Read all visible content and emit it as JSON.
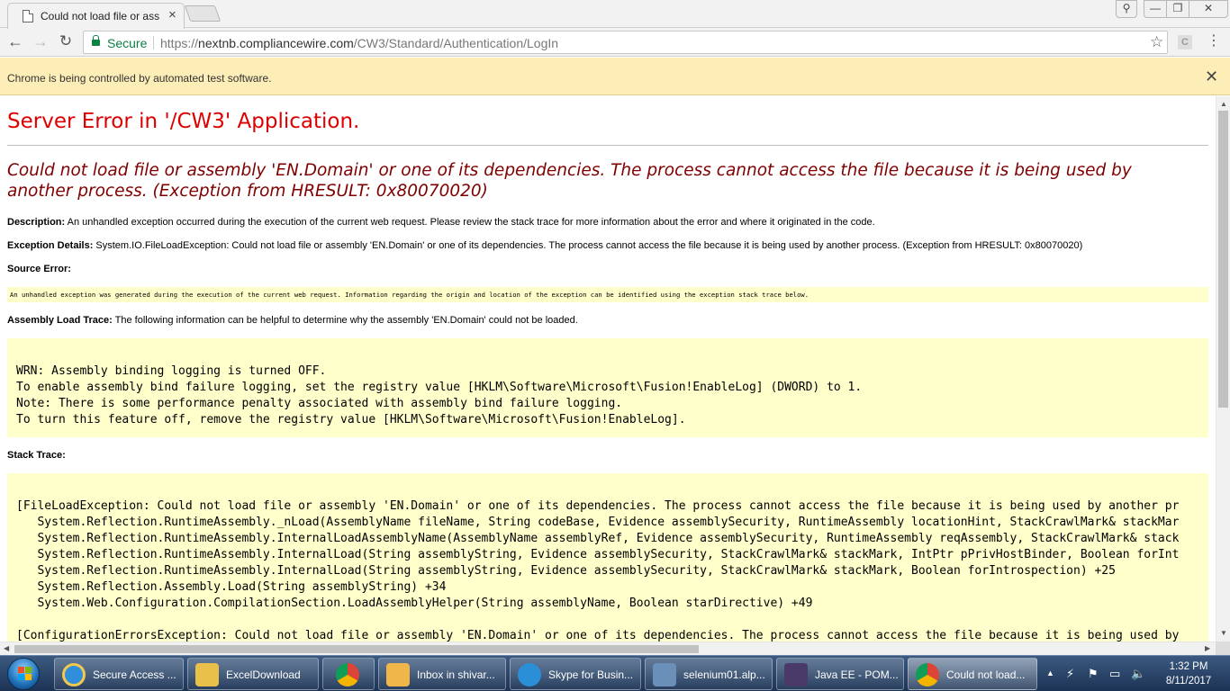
{
  "browser": {
    "tab_title": "Could not load file or ass",
    "tab_close": "×",
    "window_controls": {
      "user": "⚲",
      "minimize": "—",
      "maximize": "❐",
      "close": "✕"
    },
    "nav": {
      "back": "←",
      "forward": "→",
      "reload": "↻"
    },
    "secure_label": "Secure",
    "url_prefix": "https://",
    "url_host": "nextnb.compliancewire.com",
    "url_path": "/CW3/Standard/Authentication/LogIn",
    "star": "☆",
    "ext_label": "C",
    "menu": "⋮"
  },
  "infobar": {
    "text": "Chrome is being controlled by automated test software.",
    "close": "✕"
  },
  "page": {
    "title": "Server Error in '/CW3' Application.",
    "exception_heading": "Could not load file or assembly 'EN.Domain' or one of its dependencies. The process cannot access the file because it is being used by another process. (Exception from HRESULT: 0x80070020)",
    "description_label": "Description:",
    "description_text": " An unhandled exception occurred during the execution of the current web request. Please review the stack trace for more information about the error and where it originated in the code.",
    "exception_details_label": "Exception Details:",
    "exception_details_text": " System.IO.FileLoadException: Could not load file or assembly 'EN.Domain' or one of its dependencies. The process cannot access the file because it is being used by another process. (Exception from HRESULT: 0x80070020)",
    "source_error_label": "Source Error:",
    "source_error_text": "An unhandled exception was generated during the execution of the current web request. Information regarding the origin and location of the exception can be identified using the exception stack trace below.",
    "assembly_trace_label": "Assembly Load Trace:",
    "assembly_trace_text": " The following information can be helpful to determine why the assembly 'EN.Domain' could not be loaded.",
    "assembly_trace_code": "\nWRN: Assembly binding logging is turned OFF.\nTo enable assembly bind failure logging, set the registry value [HKLM\\Software\\Microsoft\\Fusion!EnableLog] (DWORD) to 1.\nNote: There is some performance penalty associated with assembly bind failure logging.\nTo turn this feature off, remove the registry value [HKLM\\Software\\Microsoft\\Fusion!EnableLog].",
    "stack_trace_label": "Stack Trace:",
    "stack_trace_code": "\n[FileLoadException: Could not load file or assembly 'EN.Domain' or one of its dependencies. The process cannot access the file because it is being used by another pr\n   System.Reflection.RuntimeAssembly._nLoad(AssemblyName fileName, String codeBase, Evidence assemblySecurity, RuntimeAssembly locationHint, StackCrawlMark& stackMar\n   System.Reflection.RuntimeAssembly.InternalLoadAssemblyName(AssemblyName assemblyRef, Evidence assemblySecurity, RuntimeAssembly reqAssembly, StackCrawlMark& stack\n   System.Reflection.RuntimeAssembly.InternalLoad(String assemblyString, Evidence assemblySecurity, StackCrawlMark& stackMark, IntPtr pPrivHostBinder, Boolean forInt\n   System.Reflection.RuntimeAssembly.InternalLoad(String assemblyString, Evidence assemblySecurity, StackCrawlMark& stackMark, Boolean forIntrospection) +25\n   System.Reflection.Assembly.Load(String assemblyString) +34\n   System.Web.Configuration.CompilationSection.LoadAssemblyHelper(String assemblyName, Boolean starDirective) +49\n\n[ConfigurationErrorsException: Could not load file or assembly 'EN.Domain' or one of its dependencies. The process cannot access the file because it is being used by"
  },
  "scrollbars": {
    "up": "▲",
    "down": "▼",
    "left": "◀",
    "right": "▶"
  },
  "taskbar": {
    "items": [
      {
        "label": "Secure Access ...",
        "icon": "internet-explorer-icon",
        "color": "#2f8fdc"
      },
      {
        "label": "ExcelDownload",
        "icon": "folder-icon",
        "color": "#e8c04a"
      },
      {
        "label": "",
        "icon": "chrome-icon",
        "color": "#db4437"
      },
      {
        "label": "Inbox in shivar...",
        "icon": "outlook-icon",
        "color": "#f0b64a"
      },
      {
        "label": "Skype for Busin...",
        "icon": "skype-icon",
        "color": "#2a8fd6"
      },
      {
        "label": "selenium01.alp...",
        "icon": "remote-desktop-icon",
        "color": "#6a8fb8"
      },
      {
        "label": "Java EE - POM...",
        "icon": "eclipse-icon",
        "color": "#4a3a6a"
      },
      {
        "label": "Could not load...",
        "icon": "chrome-icon",
        "color": "#db4437"
      }
    ],
    "tray": {
      "chevron": "▲",
      "network": "⚡",
      "flag": "⚑",
      "monitor": "▭",
      "volume": "🔈"
    },
    "time": "1:32 PM",
    "date": "8/11/2017"
  },
  "colors": {
    "error_title": "#dd0000",
    "exception_heading": "#800000",
    "code_background": "#ffffcc",
    "infobar_background": "#fdeeb8",
    "secure_green": "#0b8043"
  }
}
